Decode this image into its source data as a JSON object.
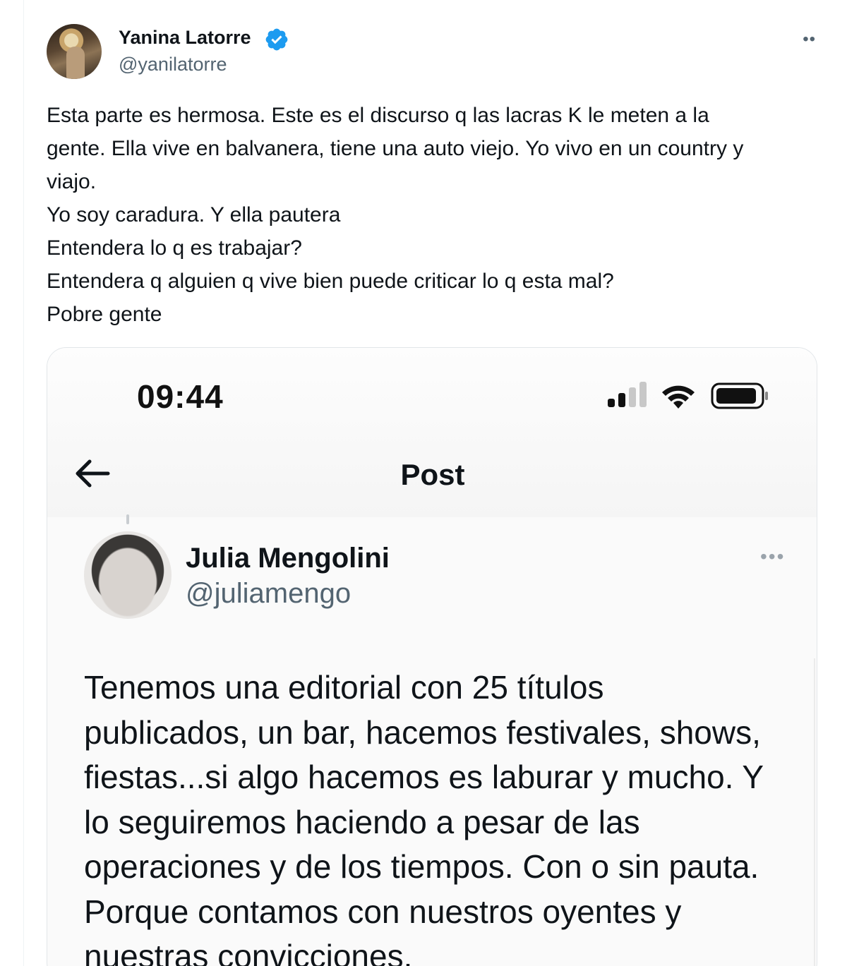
{
  "tweet": {
    "author_name": "Yanina Latorre",
    "handle": "@yanilatorre",
    "verified_icon": "verified-badge-icon",
    "more_label": "••",
    "text_lines": [
      "Esta parte es hermosa. Este es el discurso q las lacras K le meten a la",
      "gente. Ella vive en balvanera, tiene una auto viejo. Yo vivo en un country y",
      "viajo.",
      "Yo soy caradura. Y ella pautera",
      "Entendera lo q es trabajar?",
      "Entendera q alguien q vive bien puede criticar lo q esta mal?",
      "Pobre gente"
    ]
  },
  "embedded_screenshot": {
    "status_bar": {
      "time": "09:44",
      "signal_icon": "cellular-signal-icon",
      "wifi_icon": "wifi-icon",
      "battery_icon": "battery-icon"
    },
    "nav": {
      "back_icon": "back-arrow-icon",
      "title": "Post"
    },
    "post": {
      "author_name": "Julia Mengolini",
      "handle": "@juliamengo",
      "more_label": "•••",
      "text_lines": [
        "Tenemos una editorial con 25 títulos",
        "publicados, un bar, hacemos festivales, shows,",
        "fiestas...si algo hacemos es laburar y mucho. Y",
        "lo seguiremos haciendo a pesar de las",
        "operaciones y de los tiempos. Con o sin pauta.",
        "Porque contamos con nuestros oyentes y",
        "nuestras convicciones."
      ]
    }
  },
  "colors": {
    "text_primary": "#0f1419",
    "text_secondary": "#536471",
    "verified_blue": "#1d9bf0",
    "border": "#e2e6e9"
  }
}
